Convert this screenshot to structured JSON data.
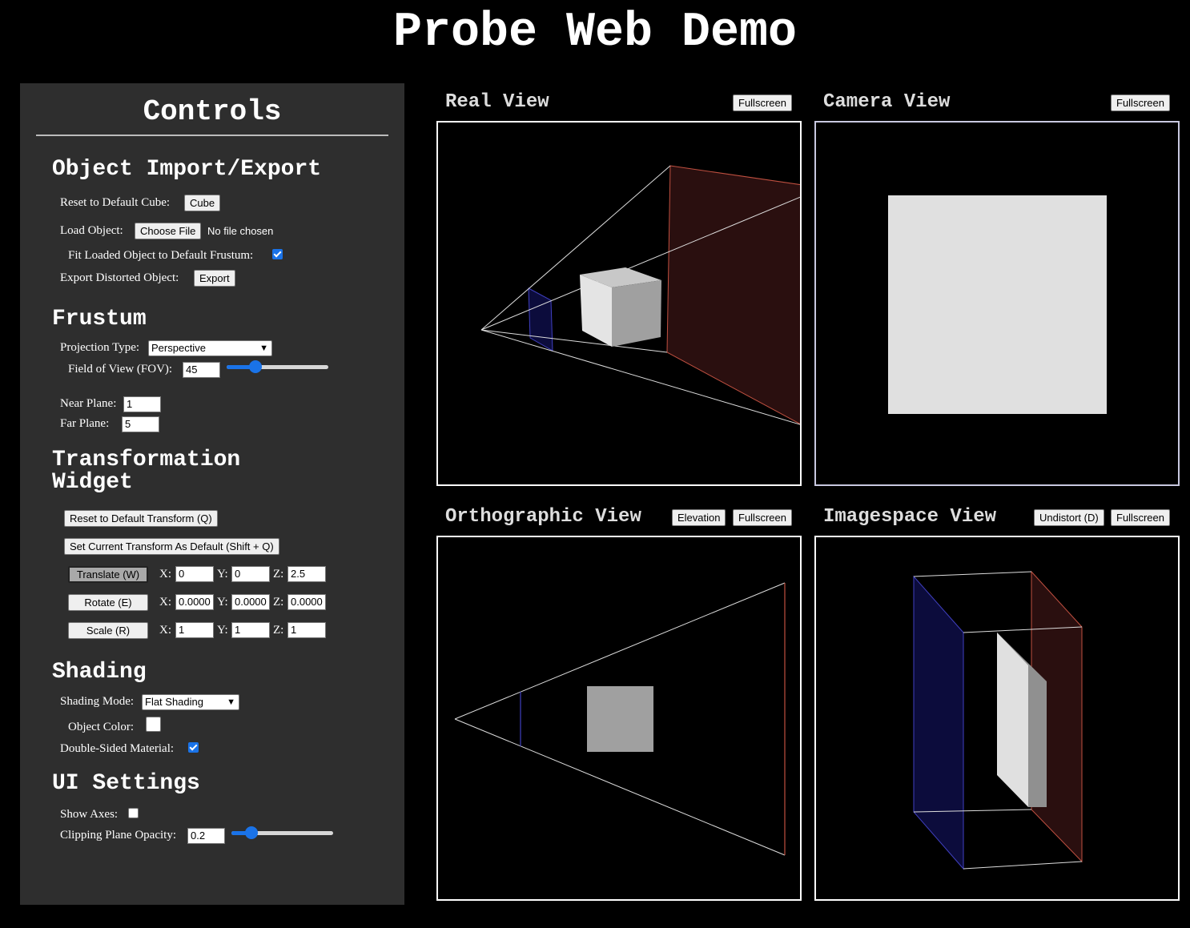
{
  "title": "Probe Web Demo",
  "controls": {
    "heading": "Controls",
    "import_export": {
      "heading": "Object Import/Export",
      "reset_label": "Reset to Default Cube:",
      "reset_button": "Cube",
      "load_label": "Load Object:",
      "choose_file_button": "Choose File",
      "file_status": "No file chosen",
      "fit_label": "Fit Loaded Object to Default Frustum:",
      "fit_checked": true,
      "export_label": "Export Distorted Object:",
      "export_button": "Export"
    },
    "frustum": {
      "heading": "Frustum",
      "projection_label": "Projection Type:",
      "projection_value": "Perspective",
      "fov_label": "Field of View (FOV):",
      "fov_value": "45",
      "fov_slider_fraction": 0.28,
      "near_label": "Near Plane:",
      "near_value": "1",
      "far_label": "Far Plane:",
      "far_value": "5"
    },
    "transform": {
      "heading_line1": "Transformation",
      "heading_line2": "Widget",
      "reset_button": "Reset to Default Transform (Q)",
      "set_default_button": "Set Current Transform As Default (Shift + Q)",
      "x_label": "X:",
      "y_label": "Y:",
      "z_label": "Z:",
      "translate": {
        "button": "Translate (W)",
        "active": true,
        "x": "0",
        "y": "0",
        "z": "2.5"
      },
      "rotate": {
        "button": "Rotate (E)",
        "active": false,
        "x": "0.0000",
        "y": "0.0000",
        "z": "0.0000"
      },
      "scale": {
        "button": "Scale (R)",
        "active": false,
        "x": "1",
        "y": "1",
        "z": "1"
      }
    },
    "shading": {
      "heading": "Shading",
      "mode_label": "Shading Mode:",
      "mode_value": "Flat Shading",
      "color_label": "Object Color:",
      "object_color": "#ffffff",
      "double_sided_label": "Double-Sided Material:",
      "double_sided_checked": true
    },
    "ui_settings": {
      "heading": "UI Settings",
      "show_axes_label": "Show Axes:",
      "show_axes_checked": false,
      "opacity_label": "Clipping Plane Opacity:",
      "opacity_value": "0.2",
      "opacity_slider_fraction": 0.2
    }
  },
  "views": {
    "real": {
      "title": "Real View",
      "fullscreen_button": "Fullscreen"
    },
    "camera": {
      "title": "Camera View",
      "fullscreen_button": "Fullscreen"
    },
    "orthographic": {
      "title": "Orthographic View",
      "elevation_button": "Elevation",
      "fullscreen_button": "Fullscreen"
    },
    "imagespace": {
      "title": "Imagespace View",
      "undistort_button": "Undistort (D)",
      "fullscreen_button": "Fullscreen"
    }
  },
  "colors": {
    "accent": "#1a73e8",
    "panel_bg": "#2e2e2e",
    "near_plane": "#3030a0",
    "far_plane": "#c05040",
    "object_light": "#e0e0e0",
    "object_mid": "#aaaaaa",
    "object_dark": "#8c8c8c"
  }
}
